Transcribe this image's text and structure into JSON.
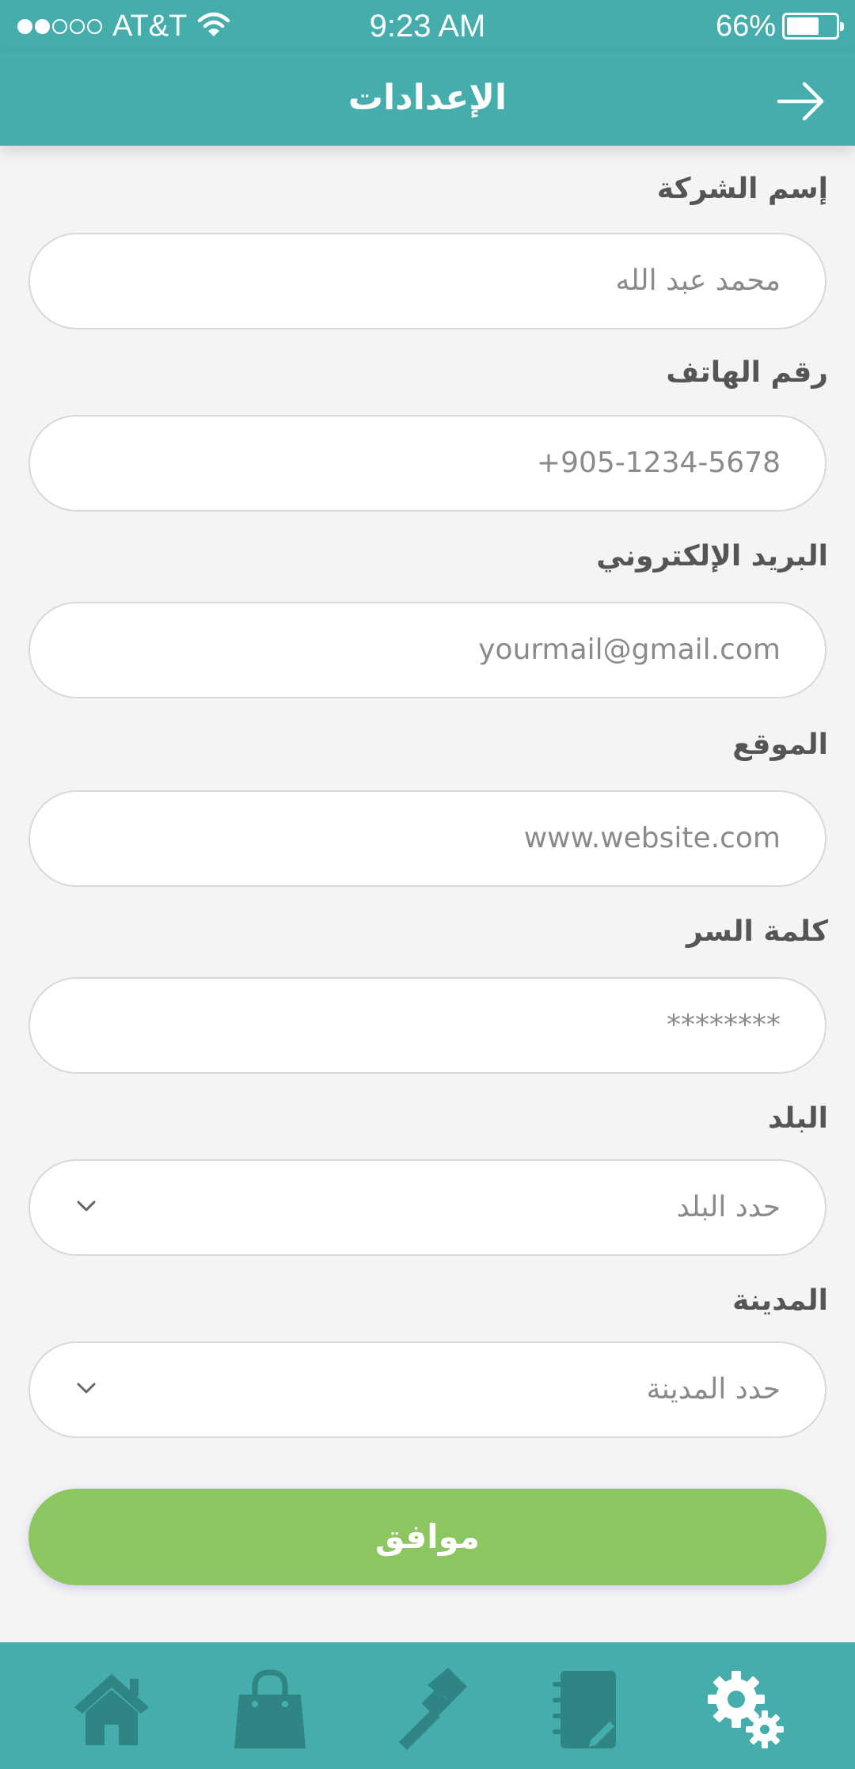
{
  "status_bar": {
    "carrier": "AT&T",
    "time": "9:23 AM",
    "battery": "66%",
    "battery_level": 0.66,
    "signal_bars": 2
  },
  "header": {
    "title": "الإعدادات",
    "back_icon": "arrow-right-icon"
  },
  "form": {
    "company_name": {
      "label": "إسم الشركة",
      "value": "محمد عبد الله"
    },
    "phone": {
      "label": "رقم الهاتف",
      "value": "+905-1234-5678"
    },
    "email": {
      "label": "البريد الإلكتروني",
      "value": "yourmail@gmail.com"
    },
    "website": {
      "label": "الموقع",
      "value": "www.website.com"
    },
    "password": {
      "label": "كلمة السر",
      "value": "********"
    },
    "country": {
      "label": "البلد",
      "placeholder": "حدد البلد"
    },
    "city": {
      "label": "المدينة",
      "placeholder": "حدد المدينة"
    },
    "submit_label": "موافق"
  },
  "bottom_nav": {
    "items": [
      {
        "icon": "home-icon",
        "active": false
      },
      {
        "icon": "shopping-bag-icon",
        "active": false
      },
      {
        "icon": "hammer-icon",
        "active": false
      },
      {
        "icon": "notebook-icon",
        "active": false
      },
      {
        "icon": "settings-gears-icon",
        "active": true
      }
    ]
  },
  "colors": {
    "primary": "#45adac",
    "accent_button": "#8bc661",
    "nav_inactive_icon": "#2f8584",
    "nav_active_icon": "#ffffff"
  }
}
